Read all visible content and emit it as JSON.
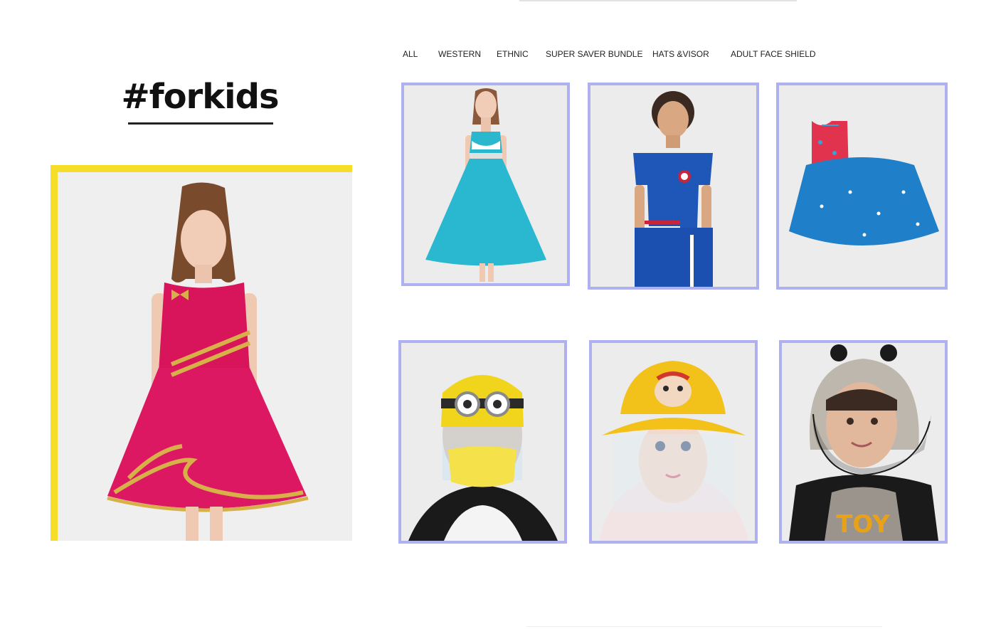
{
  "page": {
    "title": "#forkids",
    "accent_color": "#f6dd2a",
    "card_border_color": "#aeb0f0"
  },
  "tabs": [
    {
      "label": "ALL"
    },
    {
      "label": "WESTERN"
    },
    {
      "label": "ETHNIC"
    },
    {
      "label": "SUPER SAVER BUNDLE"
    },
    {
      "label": "HATS &VISOR"
    },
    {
      "label": "ADULT FACE SHIELD"
    }
  ],
  "hero": {
    "image": "girl-in-pink-dress-photo"
  },
  "products": [
    {
      "image": "girl-in-blue-dress-photo"
    },
    {
      "image": "boy-in-blue-tshirt-photo"
    },
    {
      "image": "red-top-blue-skirt-set-photo"
    },
    {
      "image": "kid-with-minion-face-shield-photo"
    },
    {
      "image": "kid-in-yellow-bucket-hat-shield-photo"
    },
    {
      "image": "kid-in-panda-hood-shield-photo"
    }
  ]
}
